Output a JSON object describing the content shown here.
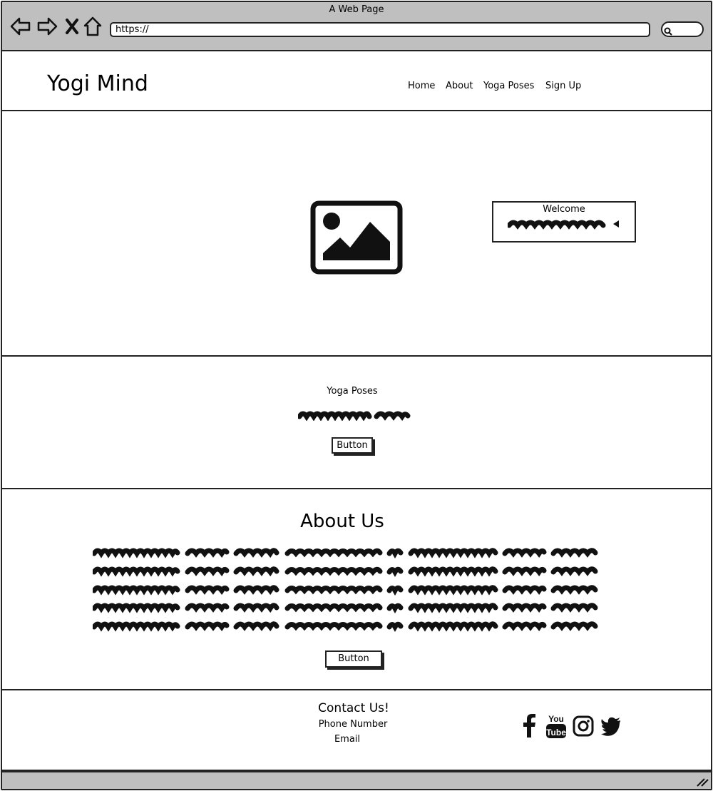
{
  "browser": {
    "window_title": "A Web Page",
    "address_value": "https://",
    "nav_buttons": [
      "back-arrow-icon",
      "forward-arrow-icon",
      "stop-icon",
      "home-icon"
    ]
  },
  "header": {
    "logo": "Yogi Mind",
    "nav": [
      {
        "label": "Home"
      },
      {
        "label": "About"
      },
      {
        "label": "Yoga Poses"
      },
      {
        "label": "Sign Up"
      }
    ]
  },
  "hero": {
    "image_icon": "image-placeholder-icon",
    "welcome_title": "Welcome"
  },
  "poses": {
    "heading": "Yoga Poses",
    "button_label": "Button"
  },
  "about": {
    "heading": "About Us",
    "button_label": "Button"
  },
  "footer": {
    "contact_heading": "Contact Us!",
    "phone_label": "Phone Number",
    "email_label": "Email",
    "social": [
      "facebook-icon",
      "youtube-icon",
      "instagram-icon",
      "twitter-icon"
    ]
  }
}
